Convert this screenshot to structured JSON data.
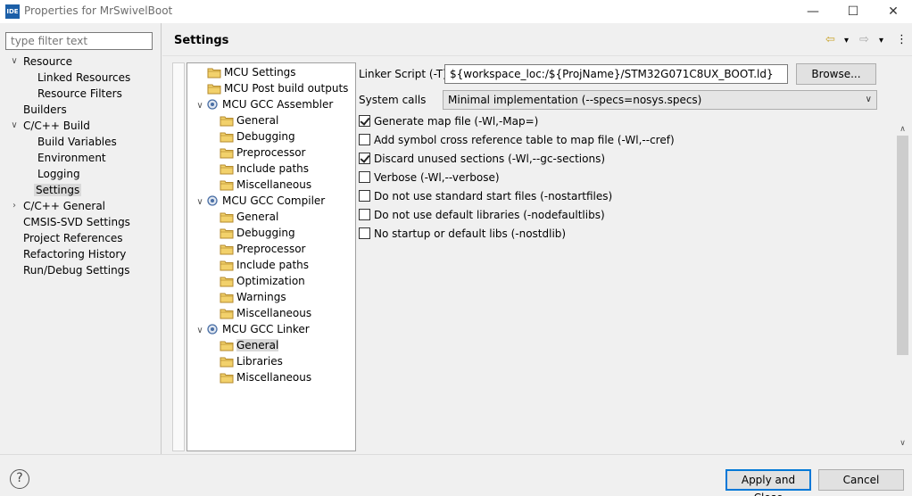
{
  "window": {
    "app_icon_text": "IDE",
    "title": "Properties for MrSwivelBoot",
    "minimize": "—",
    "maximize": "☐",
    "close": "✕"
  },
  "filter": {
    "placeholder": "type filter text"
  },
  "left_tree": [
    {
      "label": "Resource",
      "twisty": "∨"
    },
    {
      "label": "Linked Resources"
    },
    {
      "label": "Resource Filters"
    },
    {
      "label": "Builders"
    },
    {
      "label": "C/C++ Build",
      "twisty": "∨"
    },
    {
      "label": "Build Variables"
    },
    {
      "label": "Environment"
    },
    {
      "label": "Logging"
    },
    {
      "label": "Settings",
      "selected": true
    },
    {
      "label": "C/C++ General",
      "twisty": "›"
    },
    {
      "label": "CMSIS-SVD Settings"
    },
    {
      "label": "Project References"
    },
    {
      "label": "Refactoring History"
    },
    {
      "label": "Run/Debug Settings"
    }
  ],
  "header": {
    "title": "Settings",
    "back_icon": "⇦",
    "back_menu": "▾",
    "forward_icon": "⇨",
    "forward_menu": "▾",
    "more_icon": "⋮"
  },
  "settings_tree": [
    {
      "label": "MCU Settings",
      "icon": "folder-icon"
    },
    {
      "label": "MCU Post build outputs",
      "icon": "folder-icon"
    },
    {
      "label": "MCU GCC Assembler",
      "icon": "gear-icon",
      "twisty": "∨"
    },
    {
      "label": "General",
      "icon": "folder-icon"
    },
    {
      "label": "Debugging",
      "icon": "folder-icon"
    },
    {
      "label": "Preprocessor",
      "icon": "folder-icon"
    },
    {
      "label": "Include paths",
      "icon": "folder-icon"
    },
    {
      "label": "Miscellaneous",
      "icon": "folder-icon"
    },
    {
      "label": "MCU GCC Compiler",
      "icon": "gear-icon",
      "twisty": "∨"
    },
    {
      "label": "General",
      "icon": "folder-icon"
    },
    {
      "label": "Debugging",
      "icon": "folder-icon"
    },
    {
      "label": "Preprocessor",
      "icon": "folder-icon"
    },
    {
      "label": "Include paths",
      "icon": "folder-icon"
    },
    {
      "label": "Optimization",
      "icon": "folder-icon"
    },
    {
      "label": "Warnings",
      "icon": "folder-icon"
    },
    {
      "label": "Miscellaneous",
      "icon": "folder-icon"
    },
    {
      "label": "MCU GCC Linker",
      "icon": "gear-icon",
      "twisty": "∨"
    },
    {
      "label": "General",
      "icon": "folder-icon",
      "selected": true
    },
    {
      "label": "Libraries",
      "icon": "folder-icon"
    },
    {
      "label": "Miscellaneous",
      "icon": "folder-icon"
    }
  ],
  "linker": {
    "script_label": "Linker Script (-T)",
    "script_value": "${workspace_loc:/${ProjName}/STM32G071C8UX_BOOT.ld}",
    "browse_label": "Browse...",
    "syscalls_label": "System calls",
    "syscalls_value": "Minimal implementation (--specs=nosys.specs)",
    "options": [
      {
        "label": "Generate map file (-Wl,-Map=)",
        "checked": true
      },
      {
        "label": "Add symbol cross reference table to map file (-Wl,--cref)",
        "checked": false
      },
      {
        "label": "Discard unused sections (-Wl,--gc-sections)",
        "checked": true
      },
      {
        "label": "Verbose (-Wl,--verbose)",
        "checked": false
      },
      {
        "label": "Do not use standard start files (-nostartfiles)",
        "checked": false
      },
      {
        "label": "Do not use default libraries (-nodefaultlibs)",
        "checked": false
      },
      {
        "label": "No startup or default libs (-nostdlib)",
        "checked": false
      }
    ]
  },
  "scrollbar": {
    "up": "∧",
    "down": "∨"
  },
  "footer": {
    "help_icon": "?",
    "apply_close_label": "Apply and Close",
    "cancel_label": "Cancel"
  },
  "colors": {
    "accent": "#0078d7",
    "folder": "#e8b84a",
    "gear": "#4a6fa5"
  }
}
